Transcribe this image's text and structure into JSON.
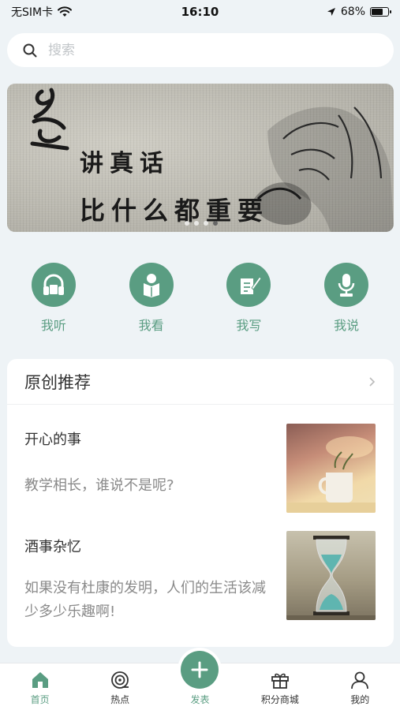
{
  "status_bar": {
    "carrier": "无SIM卡",
    "time": "16:10",
    "battery": "68%",
    "battery_level": 0.68
  },
  "search": {
    "placeholder": "搜索"
  },
  "banner": {
    "line1": "讲真话",
    "line2": "比什么都重要",
    "dot_count": 4,
    "active_dot": 3
  },
  "quick_actions": [
    {
      "label": "我听",
      "icon": "headphones-icon"
    },
    {
      "label": "我看",
      "icon": "reading-icon"
    },
    {
      "label": "我写",
      "icon": "writing-icon"
    },
    {
      "label": "我说",
      "icon": "microphone-icon"
    }
  ],
  "recommend": {
    "title": "原创推荐",
    "articles": [
      {
        "title": "开心的事",
        "desc": "教学相长，谁说不是呢?",
        "thumb": "coffee-cup-photo"
      },
      {
        "title": "酒事杂忆",
        "desc": "如果没有杜康的发明，人们的生活该减少多少乐趣啊!",
        "thumb": "hourglass-photo"
      }
    ]
  },
  "tab_bar": {
    "items": [
      {
        "label": "首页",
        "icon": "home-icon",
        "active": true
      },
      {
        "label": "热点",
        "icon": "hotspot-icon",
        "active": false
      },
      {
        "label": "发表",
        "icon": "plus-icon",
        "active": false
      },
      {
        "label": "积分商城",
        "icon": "gift-icon",
        "active": false
      },
      {
        "label": "我的",
        "icon": "user-icon",
        "active": false
      }
    ]
  },
  "colors": {
    "accent": "#5a9d82",
    "background": "#eef3f6"
  }
}
